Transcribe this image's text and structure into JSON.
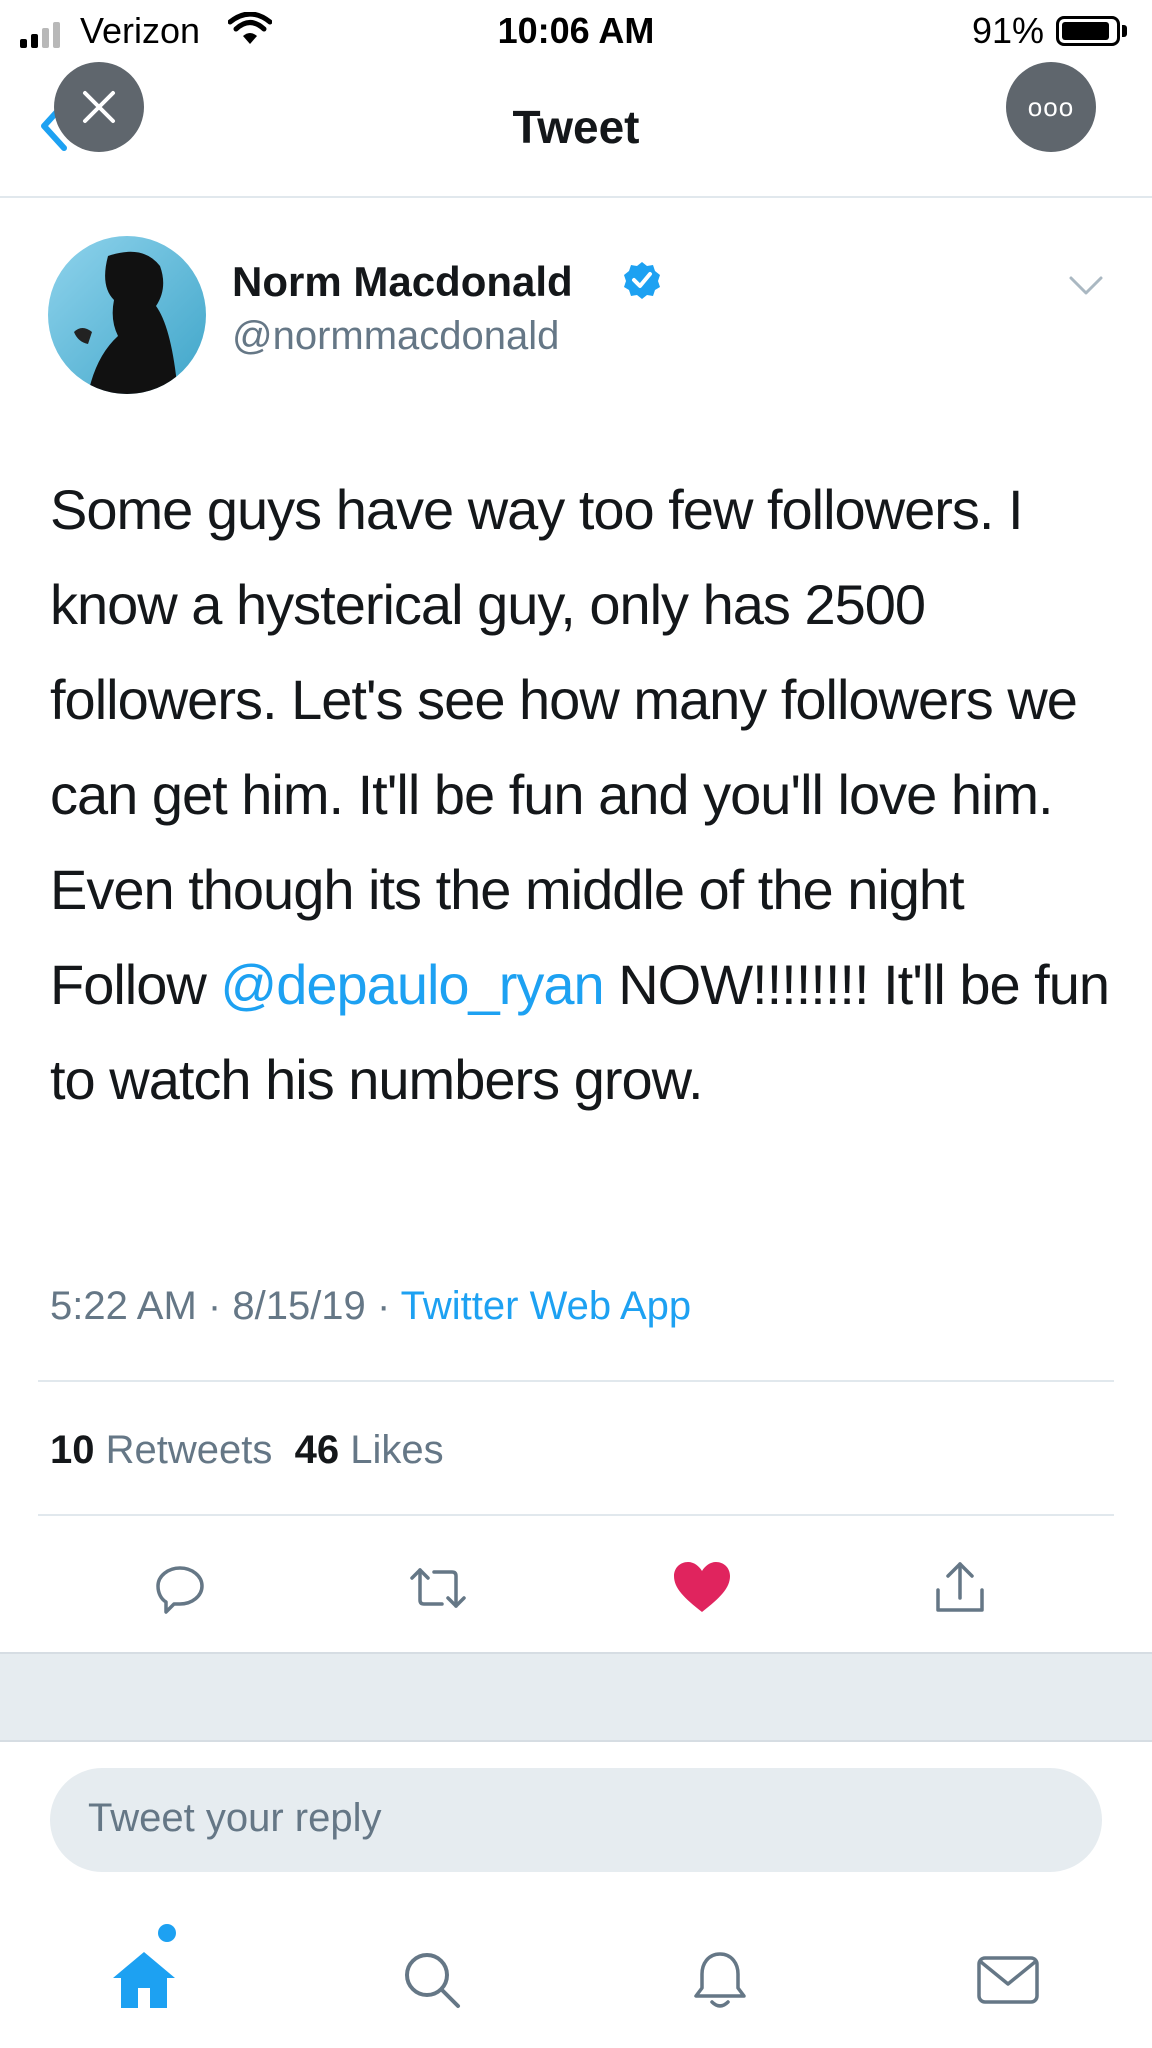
{
  "status_bar": {
    "carrier": "Verizon",
    "time": "10:06 AM",
    "battery_percent": "91%",
    "battery_level": 0.91,
    "icons": [
      "signal-icon",
      "wifi-icon",
      "battery-icon"
    ]
  },
  "header": {
    "title": "Tweet",
    "icons": [
      "back-chevron-icon",
      "close-icon",
      "more-icon"
    ],
    "more_label": "ooo"
  },
  "tweet": {
    "author_name": "Norm Macdonald",
    "author_handle": "@normmacdonald",
    "text_before_mention": "Some guys have way too few followers. I know a hysterical guy, only has 2500 followers. Let's see how many followers we can get him. It'll be fun and you'll love him. Even though its the middle of the night Follow ",
    "mention": "@depaulo_ryan",
    "text_after_mention": " NOW!!!!!!!! It'll be fun to watch his numbers grow.",
    "time": "5:22 AM",
    "date": "8/15/19",
    "source": "Twitter Web App",
    "separator": "·",
    "retweet_count": "10",
    "retweet_label": "Retweets",
    "like_count": "46",
    "like_label": "Likes"
  },
  "actions": [
    "reply-icon",
    "retweet-icon",
    "like-icon",
    "share-icon"
  ],
  "reply": {
    "placeholder": "Tweet your reply"
  },
  "tab_bar": [
    "home-icon",
    "search-icon",
    "notifications-icon",
    "messages-icon"
  ],
  "colors": {
    "accent": "#1da1f2",
    "like": "#e0245e",
    "muted": "#657786",
    "text": "#14171a",
    "divider": "#e1e8ed",
    "overlay_button": "#5f666d"
  }
}
